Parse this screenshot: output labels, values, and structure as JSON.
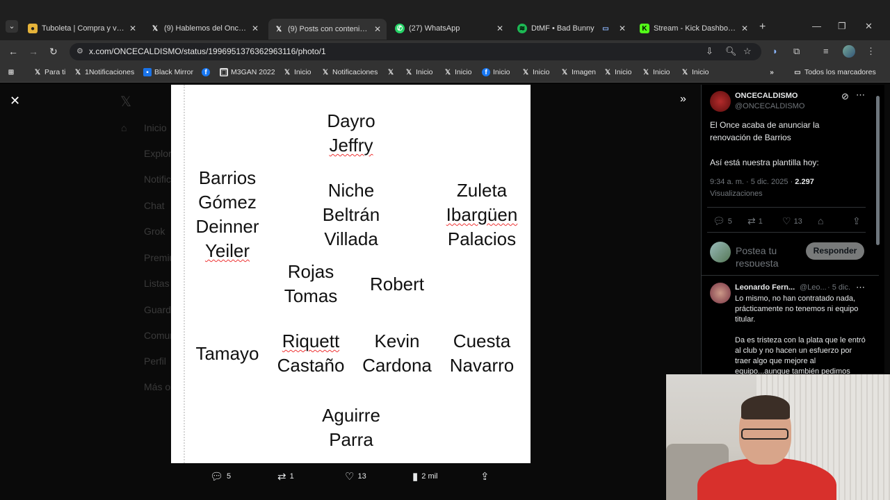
{
  "browser": {
    "tabs": [
      {
        "title": "Tuboleta | Compra y vende",
        "icon": "tuboleta-icon",
        "active": false
      },
      {
        "title": "(9) Hablemos del Once / X",
        "icon": "x-logo-icon",
        "active": false
      },
      {
        "title": "(9) Posts con contenido m",
        "icon": "x-logo-icon",
        "active": true
      },
      {
        "title": "(27) WhatsApp",
        "icon": "whatsapp-icon",
        "active": false
      },
      {
        "title": "DtMF • Bad Bunny",
        "icon": "spotify-icon",
        "active": false
      },
      {
        "title": "Stream - Kick Dashboard",
        "icon": "kick-icon",
        "active": false
      }
    ],
    "url": "x.com/ONCECALDISMO/status/1996951376362963116/photo/1",
    "bookmarks": [
      "Para ti",
      "1Notificaciones",
      "Black Mirror",
      "",
      "M3GAN 2022",
      "Inicio",
      "Notificaciones",
      "",
      "Inicio",
      "Inicio",
      "Inicio",
      "Inicio",
      "Imagen",
      "Inicio",
      "Inicio",
      "Inicio"
    ],
    "all_bookmarks": "Todos los marcadores"
  },
  "photo": {
    "names": {
      "gk1": "Dayro",
      "gk2": "Jeffry",
      "lb1": "Barrios",
      "lb2": "Gómez",
      "lb3": "Deinner",
      "lb4": "Yeiler",
      "cb1": "Niche",
      "cb2": "Beltrán",
      "cb3": "Villada",
      "rb1": "Zuleta",
      "rb2": "Ibargüen",
      "rb3": "Palacios",
      "dm1": "Rojas",
      "dm2": "Tomas",
      "am1": "Robert",
      "lw1": "Tamayo",
      "cm1": "Riquett",
      "cm2": "Castaño",
      "cm3": "Kevin",
      "cm4": "Cardona",
      "rw1": "Cuesta",
      "rw2": "Navarro",
      "st1": "Aguirre",
      "st2": "Parra"
    },
    "actions": {
      "replies": "5",
      "reposts": "1",
      "likes": "13",
      "views": "2 mil"
    }
  },
  "tweet": {
    "name": "ONCECALDISMO",
    "handle": "@ONCECALDISMO",
    "text1": "El Once acaba de anunciar la renovación de Barrios",
    "text2": "Así está nuestra plantilla hoy:",
    "time": "9:34 a. m. · 5 dic. 2025 · ",
    "views_count": "2.297",
    "views_label": "Visualizaciones",
    "replies": "5",
    "reposts": "1",
    "likes": "13",
    "reply_placeholder": "Postea tu respuesta",
    "reply_button": "Responder"
  },
  "comment": {
    "name": "Leonardo Fern...",
    "handle": "@Leo...",
    "date": "· 5 dic.",
    "text1": "Lo mismo, no han contratado nada, prácticamente no tenemos ni equipo titular.",
    "text2": "Da es tristeza con la plata que le entró al club y no hacen un esfuerzo por traer algo que mejore al equipo...aunque también pedimos"
  },
  "background_nav": [
    "Inicio",
    "Explorar",
    "Notificaciones",
    "Chat",
    "Grok",
    "Premium",
    "Listas",
    "Guardados",
    "Comunidades",
    "Perfil",
    "Más opciones"
  ],
  "colors": {
    "x_bg": "#000000",
    "photo_bg": "#ffffff",
    "chrome_bg": "#1f1f1f",
    "accent_blue": "#1d9bf0",
    "webcam_shirt": "#d8302c"
  }
}
